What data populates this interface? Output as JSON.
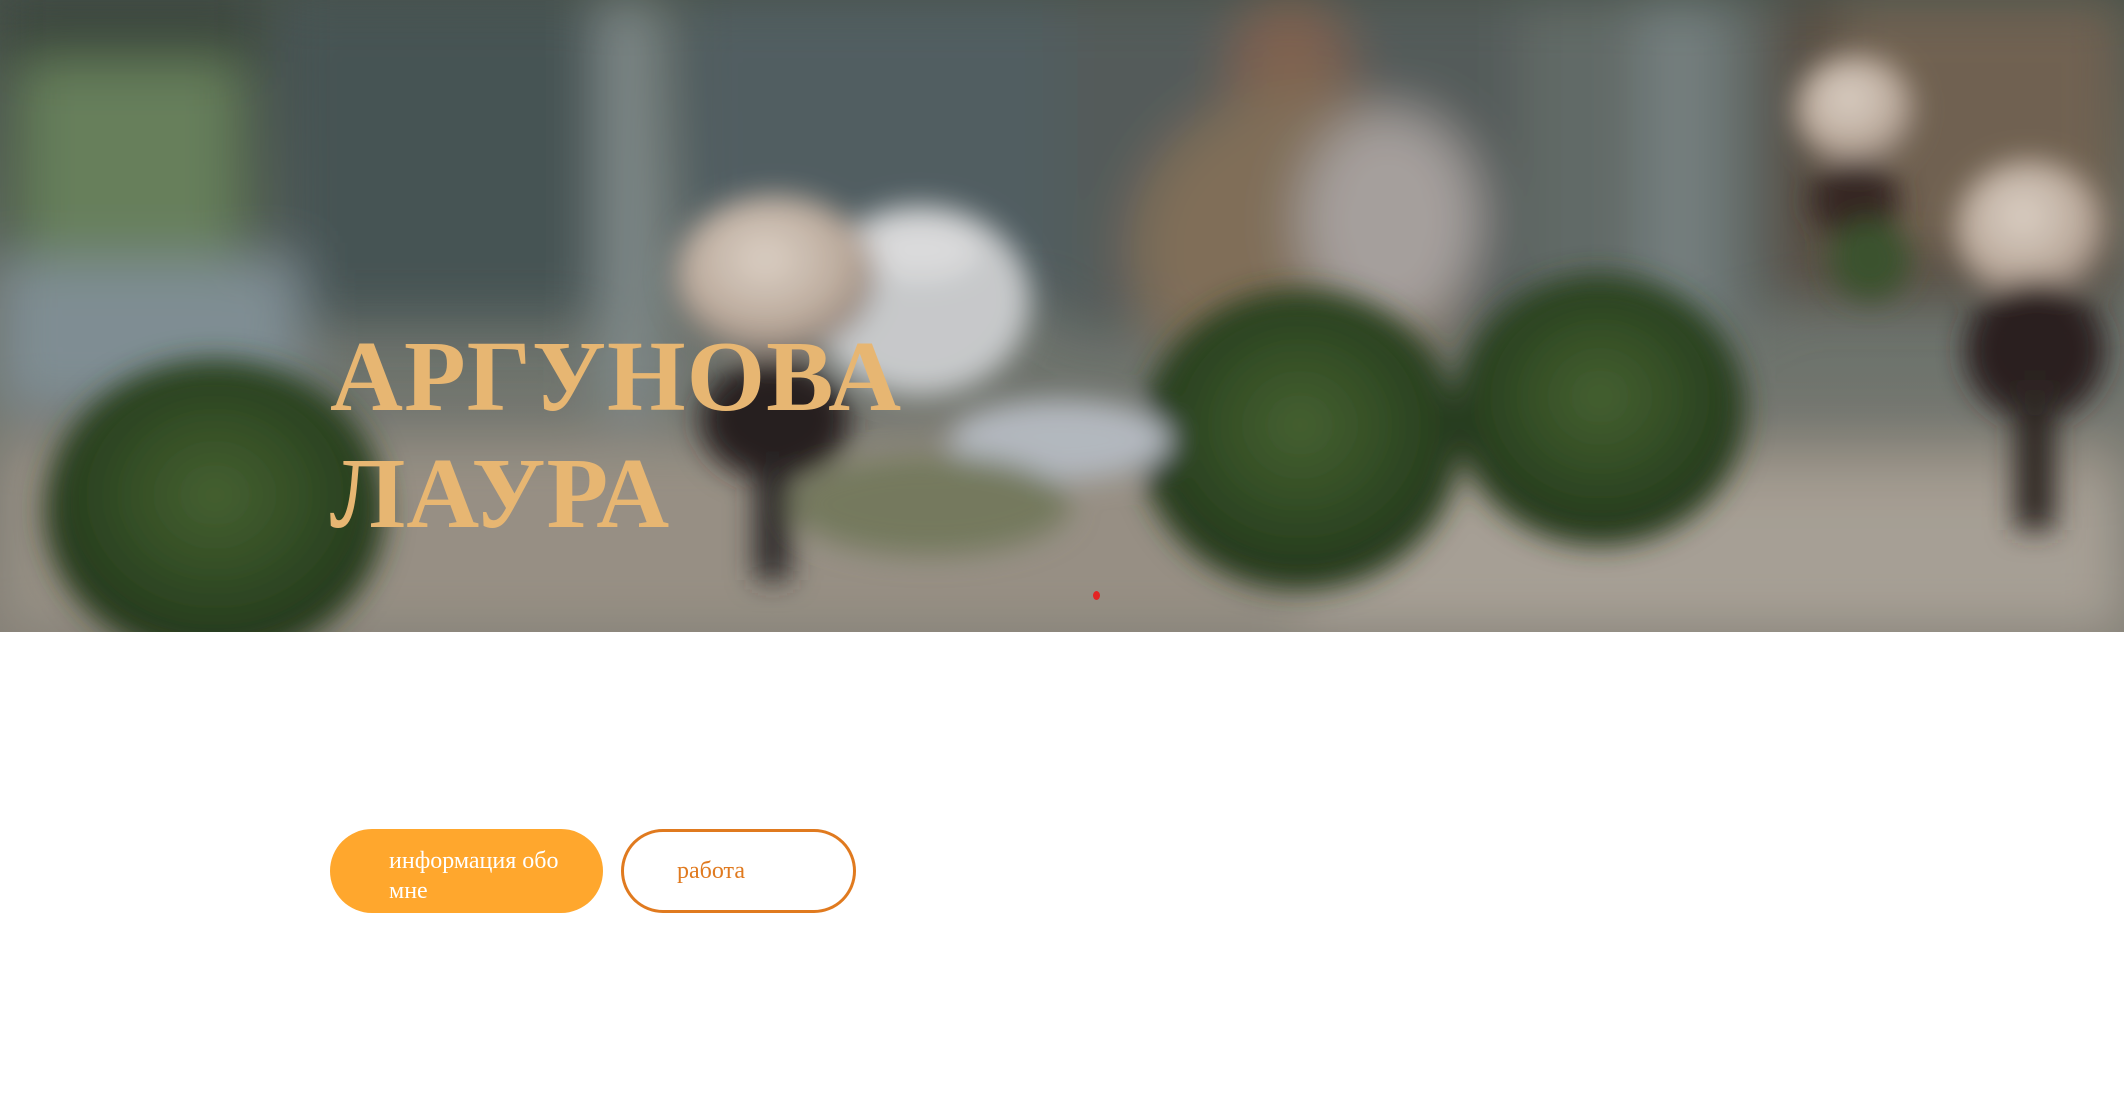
{
  "hero": {
    "name_line1": "АРГУНОВА",
    "name_line2": "ЛАУРА",
    "title_color": "#e7b672",
    "background": "blurred photo of potted topiary bushes and a person at a table in a garden cafe"
  },
  "nav_buttons": {
    "about_label_line1": "информация обо",
    "about_label_line2": "мне",
    "work_label": "работа"
  },
  "colors": {
    "accent": "#ffa72d",
    "outline": "#e07a1f",
    "slider_dot": "#e32424"
  }
}
